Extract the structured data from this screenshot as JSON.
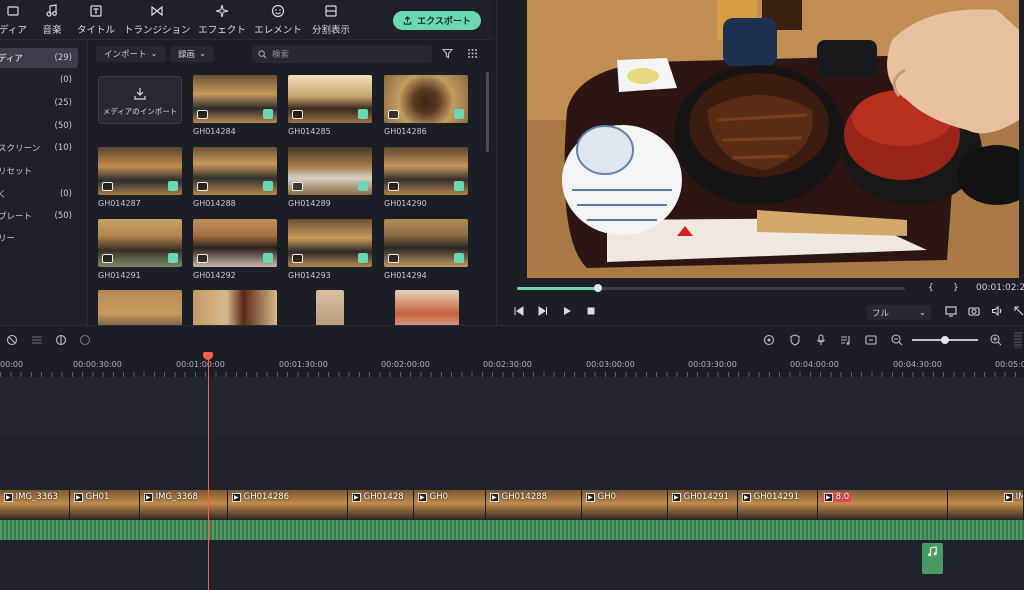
{
  "toolbar": {
    "media": "ディア",
    "audio": "音楽",
    "titles": "タイトル",
    "transitions": "トランジション",
    "effects": "エフェクト",
    "elements": "エレメント",
    "split_screen": "分割表示",
    "export": "エクスポート",
    "accent_color": "#6bd8b4"
  },
  "sidebar": {
    "items": [
      {
        "label": "ディア",
        "count": "(29)"
      },
      {
        "label": "",
        "count": "(0)"
      },
      {
        "label": "",
        "count": "(25)"
      },
      {
        "label": "",
        "count": "(50)"
      },
      {
        "label": "スクリーン",
        "count": "(10)"
      },
      {
        "label": "リセット",
        "count": ""
      },
      {
        "label": "く",
        "count": "(0)"
      },
      {
        "label": "プレート",
        "count": "(50)"
      },
      {
        "label": "リー",
        "count": ""
      }
    ]
  },
  "media_panel": {
    "import_filter": "インポート",
    "record_filter": "録画",
    "search_placeholder": "検索",
    "import_tile_label": "メディアのインポート",
    "clips": [
      "GH014284",
      "GH014285",
      "GH014286",
      "GH014287",
      "GH014288",
      "GH014289",
      "GH014290",
      "GH014291",
      "GH014292",
      "GH014293",
      "GH014294"
    ]
  },
  "preview": {
    "progress": 0.21,
    "timecode": "00:01:02:23",
    "quality": "フル",
    "bracket_open": "{",
    "bracket_close": "}"
  },
  "timeline": {
    "ruler": [
      "00:00",
      "00:00:30:00",
      "00:01:00:00",
      "00:01:30:00",
      "00:02:00:00",
      "00:02:30:00",
      "00:03:00:00",
      "00:03:30:00",
      "00:04:00:00",
      "00:04:30:00",
      "00:05:0"
    ],
    "zoom_level": 0.5,
    "clip_labels": [
      "IMG_3363",
      "GH01",
      "IMG_3368",
      "GH014286",
      "GH01428",
      "GH0",
      "GH014288",
      "GH0",
      "GH014291",
      "GH014291",
      "8.0",
      "IM"
    ]
  }
}
